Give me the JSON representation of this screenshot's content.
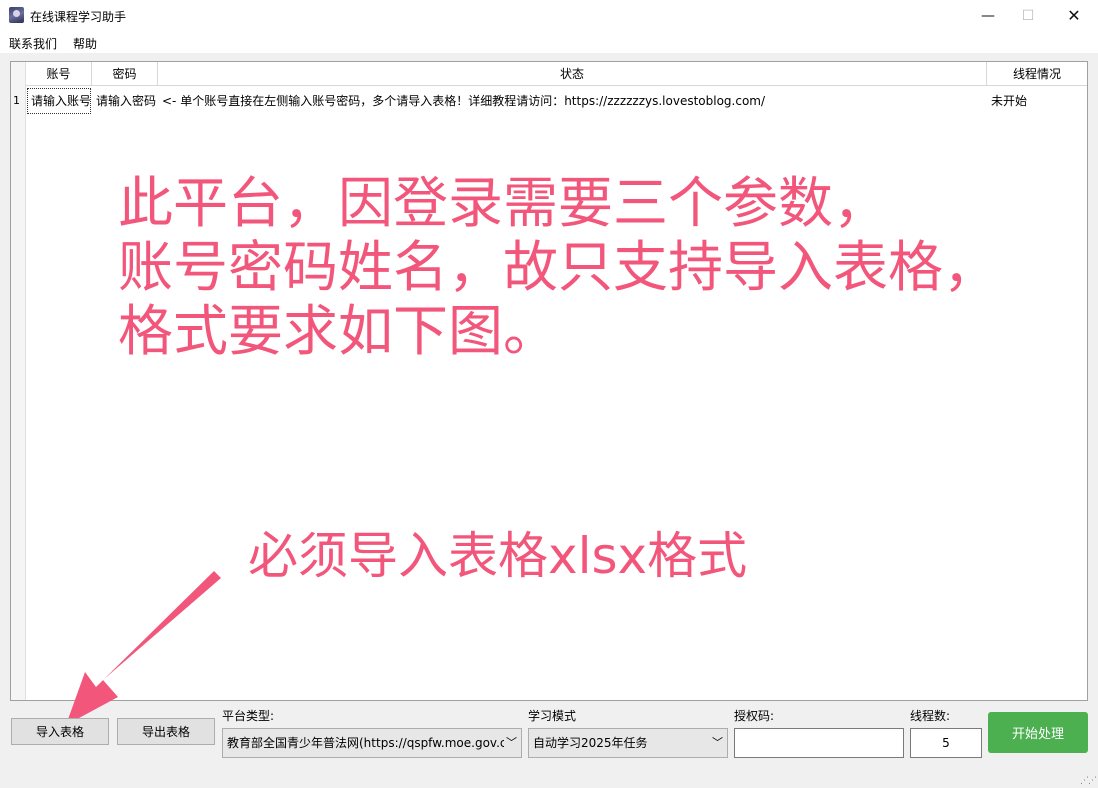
{
  "window": {
    "title": "在线课程学习助手",
    "icon": "app-icon",
    "minimize": "—",
    "maximize": "☐",
    "close": "✕"
  },
  "menu": {
    "items": [
      "联系我们",
      "帮助"
    ]
  },
  "table": {
    "columns": [
      "账号",
      "密码",
      "状态",
      "线程情况"
    ],
    "rows": [
      {
        "num": "1",
        "account": "请输入账号",
        "password": "请输入密码",
        "status": "<- 单个账号直接在左侧输入账号密码，多个请导入表格！详细教程请访问：https://zzzzzzys.lovestoblog.com/",
        "thread": "未开始"
      }
    ]
  },
  "annotations": {
    "main_lines": [
      "此平台，因登录需要三个参数，",
      "账号密码姓名，故只支持导入表格，",
      "格式要求如下图。"
    ],
    "secondary": "必须导入表格xlsx格式",
    "color": "#f2567a"
  },
  "controls": {
    "import_label": "导入表格",
    "export_label": "导出表格",
    "platform_label": "平台类型:",
    "platform_value": "教育部全国青少年普法网(https://qspfw.moe.gov.c",
    "mode_label": "学习模式",
    "mode_value": "自动学习2025年任务",
    "auth_label": "授权码:",
    "auth_value": "",
    "threads_label": "线程数:",
    "threads_value": "5",
    "start_label": "开始处理",
    "start_color": "#4caf50"
  }
}
